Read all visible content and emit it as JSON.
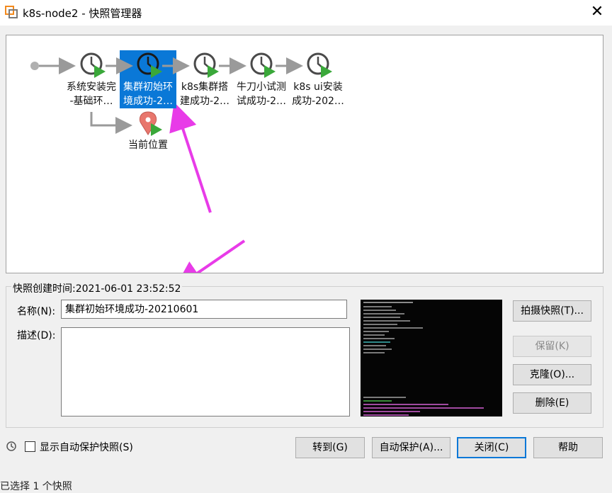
{
  "window": {
    "title": "k8s-node2 - 快照管理器",
    "close_label": "✕"
  },
  "snapshots": [
    {
      "label_line1": "系统安装完",
      "label_line2": "-基础环…",
      "selected": false
    },
    {
      "label_line1": "集群初始环",
      "label_line2": "境成功-2…",
      "selected": true
    },
    {
      "label_line1": "k8s集群搭",
      "label_line2": "建成功-2…",
      "selected": false
    },
    {
      "label_line1": "牛刀小试测",
      "label_line2": "试成功-2…",
      "selected": false
    },
    {
      "label_line1": "k8s ui安装",
      "label_line2": "成功-202…",
      "selected": false
    }
  ],
  "current_location_label": "当前位置",
  "details": {
    "created_text": "快照创建时间:2021-06-01 23:52:52",
    "name_label": "名称(N):",
    "name_value": "集群初始环境成功-20210601",
    "desc_label": "描述(D):",
    "desc_value": ""
  },
  "buttons": {
    "take_snapshot": "拍摄快照(T)...",
    "keep": "保留(K)",
    "clone": "克隆(O)...",
    "delete": "删除(E)",
    "goto": "转到(G)",
    "autoprotect": "自动保护(A)...",
    "close": "关闭(C)",
    "help": "帮助"
  },
  "show_autoprotect_label": "显示自动保护快照(S)",
  "status_text": "已选择 1 个快照",
  "colors": {
    "selection": "#0a78d7",
    "annotation_arrow": "#e83be8",
    "play_green": "#3aa83a",
    "location_pin": "#e8766c"
  }
}
